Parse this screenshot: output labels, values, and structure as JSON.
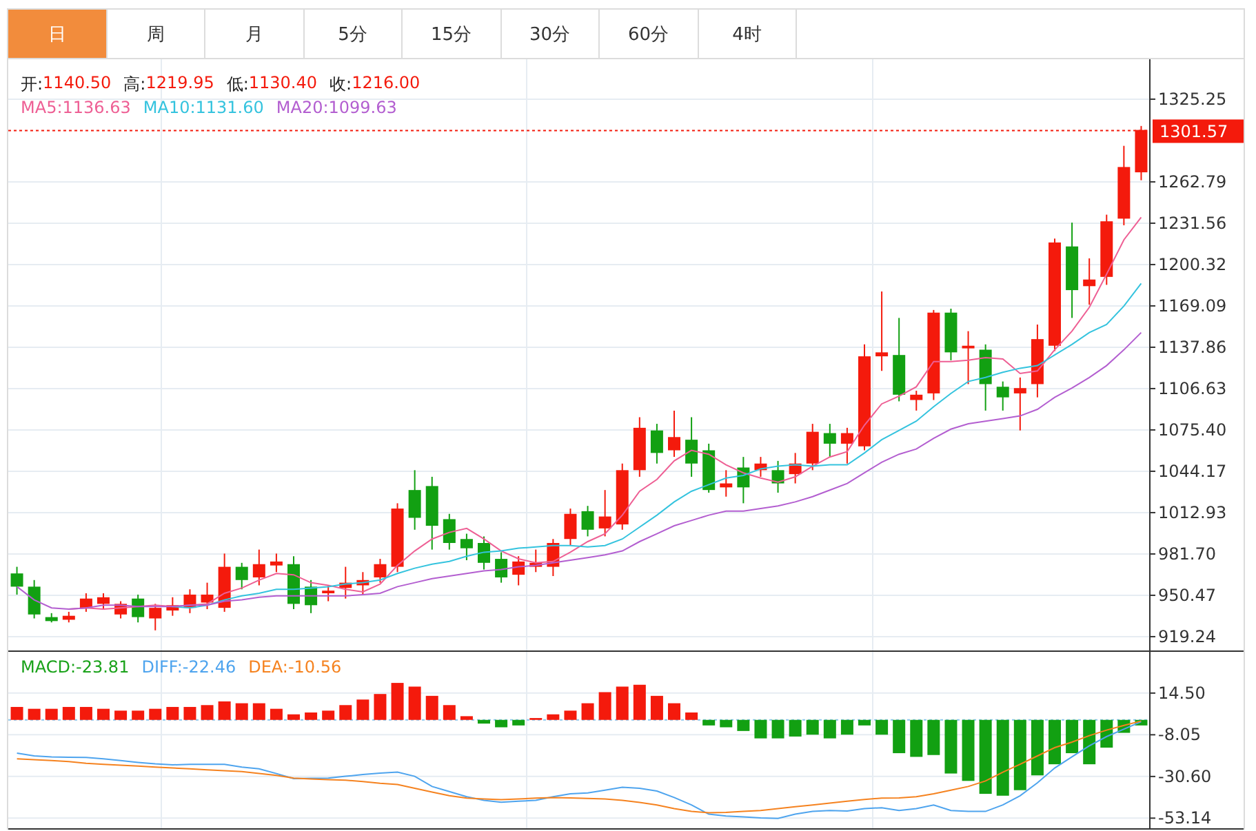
{
  "tabs": [
    {
      "label": "日",
      "selected": true
    },
    {
      "label": "周",
      "selected": false
    },
    {
      "label": "月",
      "selected": false
    },
    {
      "label": "5分",
      "selected": false
    },
    {
      "label": "15分",
      "selected": false
    },
    {
      "label": "30分",
      "selected": false
    },
    {
      "label": "60分",
      "selected": false
    },
    {
      "label": "4时",
      "selected": false
    }
  ],
  "price_panel": {
    "ohlc_legend": [
      {
        "label": "开:",
        "value": "1140.50"
      },
      {
        "label": "高:",
        "value": "1219.95"
      },
      {
        "label": "低:",
        "value": "1130.40"
      },
      {
        "label": "收:",
        "value": "1216.00"
      }
    ],
    "ma_legend": [
      {
        "label": "MA5:",
        "value": "1136.63",
        "color": "#ee5f94"
      },
      {
        "label": "MA10:",
        "value": "1131.60",
        "color": "#34c3de"
      },
      {
        "label": "MA20:",
        "value": "1099.63",
        "color": "#b35ed0"
      }
    ],
    "chart_data": {
      "type": "candlestick",
      "categories": [
        null,
        null,
        null,
        null,
        null,
        null,
        null,
        null,
        null,
        null,
        null,
        null,
        null,
        null,
        null,
        null,
        null,
        null,
        null,
        null,
        null,
        null,
        null,
        null,
        null,
        null,
        null,
        null,
        null,
        null,
        null,
        null,
        null,
        null,
        null,
        null,
        null,
        null,
        null,
        null,
        null,
        null,
        null,
        null,
        null,
        null,
        null,
        null,
        null,
        null,
        null,
        null,
        null,
        null,
        null,
        null,
        null,
        null,
        null,
        null,
        null,
        null,
        null,
        null,
        null,
        null
      ],
      "grid": true,
      "ylim": [
        908.8,
        1355.4
      ],
      "yticks": [
        {
          "value": 1325.25,
          "label": "1325.25"
        },
        {
          "value": 1262.79,
          "label": "1262.79"
        },
        {
          "value": 1231.56,
          "label": "1231.56"
        },
        {
          "value": 1200.32,
          "label": "1200.32"
        },
        {
          "value": 1169.09,
          "label": "1169.09"
        },
        {
          "value": 1137.86,
          "label": "1137.86"
        },
        {
          "value": 1106.63,
          "label": "1106.63"
        },
        {
          "value": 1075.4,
          "label": "1075.40"
        },
        {
          "value": 1044.17,
          "label": "1044.17"
        },
        {
          "value": 1012.93,
          "label": "1012.93"
        },
        {
          "value": 981.7,
          "label": "981.70"
        },
        {
          "value": 950.47,
          "label": "950.47"
        },
        {
          "value": 919.24,
          "label": "919.24"
        }
      ],
      "ref_lines": [
        {
          "axis": "y",
          "value": 1301.57,
          "label": "1301.57",
          "color": "#f41a0c"
        }
      ],
      "ohlc": [
        [
          967,
          972,
          951,
          957
        ],
        [
          957,
          962,
          933,
          936
        ],
        [
          934,
          937,
          930,
          931
        ],
        [
          932,
          938,
          930,
          935
        ],
        [
          941,
          952,
          938,
          948
        ],
        [
          944,
          952,
          940,
          949
        ],
        [
          936,
          946,
          933,
          944
        ],
        [
          948,
          951,
          930,
          934
        ],
        [
          933,
          944,
          924,
          941
        ],
        [
          939,
          949,
          935,
          943
        ],
        [
          941,
          955,
          937,
          951
        ],
        [
          945,
          960,
          940,
          951
        ],
        [
          941,
          982,
          938,
          972
        ],
        [
          972,
          975,
          955,
          962
        ],
        [
          964,
          985,
          958,
          974
        ],
        [
          973,
          982,
          968,
          976
        ],
        [
          974,
          980,
          940,
          944
        ],
        [
          957,
          962,
          937,
          943
        ],
        [
          952,
          958,
          946,
          954
        ],
        [
          956,
          972,
          948,
          960
        ],
        [
          958,
          968,
          951,
          962
        ],
        [
          964,
          978,
          960,
          974
        ],
        [
          972,
          1020,
          968,
          1016
        ],
        [
          1030,
          1045,
          1000,
          1009
        ],
        [
          1033,
          1040,
          985,
          1003
        ],
        [
          1008,
          1012,
          985,
          990
        ],
        [
          993,
          997,
          977,
          986
        ],
        [
          990,
          995,
          970,
          975
        ],
        [
          978,
          983,
          960,
          964
        ],
        [
          966,
          980,
          958,
          976
        ],
        [
          972,
          985,
          968,
          975
        ],
        [
          972,
          993,
          965,
          990
        ],
        [
          993,
          1016,
          988,
          1012
        ],
        [
          1014,
          1018,
          995,
          1000
        ],
        [
          1001,
          1030,
          995,
          1010
        ],
        [
          1004,
          1050,
          1000,
          1045
        ],
        [
          1045,
          1085,
          1040,
          1077
        ],
        [
          1075,
          1080,
          1050,
          1058
        ],
        [
          1060,
          1090,
          1055,
          1070
        ],
        [
          1068,
          1085,
          1040,
          1050
        ],
        [
          1060,
          1065,
          1028,
          1030
        ],
        [
          1032,
          1045,
          1025,
          1035
        ],
        [
          1047,
          1055,
          1020,
          1032
        ],
        [
          1045,
          1055,
          1040,
          1050
        ],
        [
          1045,
          1052,
          1028,
          1035
        ],
        [
          1042,
          1058,
          1035,
          1050
        ],
        [
          1050,
          1080,
          1045,
          1074
        ],
        [
          1073,
          1080,
          1055,
          1065
        ],
        [
          1065,
          1077,
          1050,
          1073
        ],
        [
          1063,
          1140,
          1060,
          1131
        ],
        [
          1131,
          1180,
          1120,
          1134
        ],
        [
          1132,
          1160,
          1097,
          1102
        ],
        [
          1098,
          1105,
          1090,
          1102
        ],
        [
          1103,
          1166,
          1098,
          1164
        ],
        [
          1164,
          1167,
          1128,
          1134
        ],
        [
          1137,
          1150,
          1110,
          1139
        ],
        [
          1136,
          1140,
          1090,
          1110
        ],
        [
          1108,
          1112,
          1090,
          1100
        ],
        [
          1103,
          1115,
          1075,
          1107
        ],
        [
          1110,
          1155,
          1100,
          1144
        ],
        [
          1139,
          1220,
          1135,
          1217
        ],
        [
          1214,
          1232,
          1160,
          1181
        ],
        [
          1184,
          1205,
          1170,
          1189
        ],
        [
          1191,
          1238,
          1185,
          1233
        ],
        [
          1235,
          1290,
          1230,
          1274
        ],
        [
          1270,
          1305,
          1264,
          1302
        ]
      ],
      "series": [
        {
          "type": "line",
          "color": "#ee5f94",
          "values": [
            null,
            null,
            null,
            940,
            941,
            940,
            941,
            942,
            943,
            942,
            943,
            944,
            952,
            956,
            962,
            967,
            966,
            960,
            958,
            955,
            953,
            959,
            973,
            984,
            993,
            998,
            1001,
            993,
            984,
            978,
            975,
            976,
            983,
            991,
            997,
            1011,
            1029,
            1038,
            1052,
            1060,
            1057,
            1049,
            1043,
            1039,
            1036,
            1040,
            1048,
            1055,
            1059,
            1079,
            1095,
            1101,
            1108,
            1127,
            1127,
            1128,
            1130,
            1129,
            1118,
            1120,
            1136,
            1150,
            1168,
            1193,
            1219,
            1236
          ]
        },
        {
          "type": "line",
          "color": "#34c3de",
          "values": [
            null,
            null,
            null,
            null,
            null,
            null,
            null,
            null,
            null,
            942,
            941,
            943,
            947,
            950,
            952,
            955,
            955,
            956,
            957,
            959,
            960,
            962,
            967,
            971,
            974,
            976,
            980,
            983,
            984,
            986,
            987,
            988,
            988,
            987,
            988,
            993,
            1002,
            1011,
            1021,
            1029,
            1034,
            1039,
            1041,
            1046,
            1048,
            1049,
            1048,
            1049,
            1049,
            1058,
            1068,
            1075,
            1082,
            1093,
            1103,
            1112,
            1115,
            1119,
            1122,
            1124,
            1132,
            1140,
            1149,
            1155,
            1169,
            1186
          ]
        },
        {
          "type": "line",
          "color": "#b35ed0",
          "values": [
            957,
            947,
            941,
            940,
            941,
            943,
            943,
            942,
            942,
            942,
            943,
            943,
            946,
            947,
            949,
            950,
            950,
            950,
            950,
            950,
            951,
            952,
            957,
            960,
            963,
            965,
            967,
            969,
            970,
            972,
            973,
            975,
            977,
            979,
            981,
            984,
            991,
            997,
            1003,
            1007,
            1011,
            1014,
            1014,
            1016,
            1018,
            1021,
            1025,
            1030,
            1035,
            1043,
            1051,
            1057,
            1061,
            1069,
            1076,
            1080,
            1082,
            1084,
            1086,
            1091,
            1100,
            1107,
            1115,
            1124,
            1136,
            1149
          ]
        }
      ]
    }
  },
  "macd_panel": {
    "legend": [
      {
        "label": "MACD:",
        "value": "-23.81",
        "color": "#1aa21a"
      },
      {
        "label": "DIFF:",
        "value": "-22.46",
        "color": "#4ea4ee"
      },
      {
        "label": "DEA:",
        "value": "-10.56",
        "color": "#f5821f"
      }
    ],
    "chart_data": {
      "type": "bar",
      "categories": [
        null,
        null,
        null,
        null,
        null,
        null,
        null,
        null,
        null,
        null,
        null,
        null,
        null,
        null,
        null,
        null,
        null,
        null,
        null,
        null,
        null,
        null,
        null,
        null,
        null,
        null,
        null,
        null,
        null,
        null,
        null,
        null,
        null,
        null,
        null,
        null,
        null,
        null,
        null,
        null,
        null,
        null,
        null,
        null,
        null,
        null,
        null,
        null,
        null,
        null,
        null,
        null,
        null,
        null,
        null,
        null,
        null,
        null,
        null,
        null,
        null,
        null,
        null,
        null,
        null,
        null
      ],
      "grid": true,
      "ylim": [
        -58.6,
        36.8
      ],
      "yticks": [
        {
          "value": 14.5,
          "label": "14.50"
        },
        {
          "value": -8.05,
          "label": "-8.05"
        },
        {
          "value": -30.6,
          "label": "-30.60"
        },
        {
          "value": -53.14,
          "label": "-53.14"
        }
      ],
      "ref_lines": [
        {
          "axis": "y",
          "value": 0,
          "color": "#8cc8ee"
        }
      ],
      "series": [
        {
          "values": [
            7,
            6,
            6,
            7,
            7,
            6,
            5,
            5,
            6,
            7,
            7,
            8,
            10,
            9,
            9,
            6,
            3,
            4,
            5,
            8,
            11,
            14,
            20,
            18,
            13,
            8,
            2,
            -2,
            -4,
            -3,
            1,
            3,
            5,
            9,
            15,
            18,
            19,
            13,
            9,
            4,
            -3,
            -4,
            -6,
            -10,
            -10,
            -9,
            -8,
            -10,
            -8,
            -3,
            -8,
            -18,
            -20,
            -19,
            -29,
            -33,
            -40,
            -41,
            -38,
            -30,
            -24,
            -18,
            -24,
            -15,
            -7,
            -3
          ],
          "colors": [
            "#f41a0c",
            "#f41a0c",
            "#f41a0c",
            "#f41a0c",
            "#f41a0c",
            "#f41a0c",
            "#f41a0c",
            "#f41a0c",
            "#f41a0c",
            "#f41a0c",
            "#f41a0c",
            "#f41a0c",
            "#f41a0c",
            "#f41a0c",
            "#f41a0c",
            "#f41a0c",
            "#f41a0c",
            "#f41a0c",
            "#f41a0c",
            "#f41a0c",
            "#f41a0c",
            "#f41a0c",
            "#f41a0c",
            "#f41a0c",
            "#f41a0c",
            "#f41a0c",
            "#f41a0c",
            "#12a012",
            "#12a012",
            "#12a012",
            "#f41a0c",
            "#f41a0c",
            "#f41a0c",
            "#f41a0c",
            "#f41a0c",
            "#f41a0c",
            "#f41a0c",
            "#f41a0c",
            "#f41a0c",
            "#f41a0c",
            "#12a012",
            "#12a012",
            "#12a012",
            "#12a012",
            "#12a012",
            "#12a012",
            "#12a012",
            "#12a012",
            "#12a012",
            "#12a012",
            "#12a012",
            "#12a012",
            "#12a012",
            "#12a012",
            "#12a012",
            "#12a012",
            "#12a012",
            "#12a012",
            "#12a012",
            "#12a012",
            "#12a012",
            "#12a012",
            "#12a012",
            "#12a012",
            "#12a012",
            "#12a012"
          ]
        },
        {
          "type": "line",
          "color": "#4ea4ee",
          "values": [
            -18,
            -19.5,
            -20,
            -20.2,
            -20.3,
            -21,
            -22,
            -23,
            -23.8,
            -24.3,
            -24,
            -24,
            -24,
            -25.5,
            -26.5,
            -29,
            -31.8,
            -31.6,
            -31.5,
            -30.5,
            -29.5,
            -28.8,
            -28.3,
            -30.5,
            -36,
            -38.8,
            -41.5,
            -43.5,
            -44.5,
            -44,
            -43.5,
            -41.5,
            -40,
            -39.5,
            -38,
            -36.5,
            -37,
            -38.5,
            -42,
            -46,
            -51,
            -52,
            -52.4,
            -53,
            -53.3,
            -51,
            -49.5,
            -49,
            -49.3,
            -48,
            -47.5,
            -49,
            -48,
            -46,
            -49,
            -49.5,
            -49.5,
            -46,
            -41,
            -34,
            -26,
            -20,
            -14,
            -9,
            -5,
            -1
          ]
        },
        {
          "type": "line",
          "color": "#f5821f",
          "values": [
            -21,
            -21.5,
            -22,
            -22.5,
            -23.5,
            -24,
            -24.5,
            -25,
            -25.5,
            -26,
            -26.5,
            -27,
            -27.5,
            -28,
            -29,
            -30,
            -31.5,
            -32,
            -32.4,
            -32.6,
            -33.3,
            -34.3,
            -35,
            -37,
            -39,
            -41,
            -42.3,
            -42.8,
            -43.2,
            -42.8,
            -42.3,
            -42,
            -42.2,
            -42.5,
            -42.7,
            -43.5,
            -44.6,
            -46,
            -48,
            -49.5,
            -50.2,
            -50,
            -49.5,
            -49,
            -48,
            -47,
            -46,
            -45,
            -44,
            -43,
            -42.3,
            -42.2,
            -41.5,
            -40,
            -38,
            -36,
            -33,
            -28.3,
            -24,
            -19.5,
            -15,
            -12,
            -8.5,
            -5.5,
            -3,
            -0.6
          ]
        }
      ]
    }
  }
}
